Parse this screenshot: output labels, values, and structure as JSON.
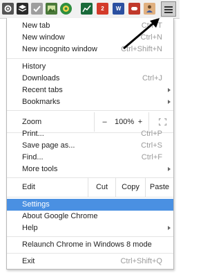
{
  "toolbar": {
    "extensions": [
      {
        "icon": "gear-icon",
        "bg": "#555555"
      },
      {
        "icon": "layers-icon",
        "bg": "#2b2b2b"
      },
      {
        "icon": "check-icon",
        "bg": "#9e9e9e"
      },
      {
        "icon": "image-icon",
        "bg": "#4a7a3a"
      },
      {
        "icon": "circle-badge-icon",
        "bg": "#2f8f3f"
      },
      {
        "icon": "chart-icon",
        "bg": "#1a6a3a"
      },
      {
        "icon": "mail-badge-icon",
        "bg": "#d33a2a",
        "text": "2"
      },
      {
        "icon": "word-badge-icon",
        "bg": "#2a4fa0",
        "text": "W"
      },
      {
        "icon": "pill-icon",
        "bg": "#c0392b"
      },
      {
        "icon": "person-icon",
        "bg": "#e0b080"
      }
    ],
    "menu_button_icon": "hamburger-menu-icon"
  },
  "menu": {
    "new_tab": "New tab",
    "new_tab_shortcut": "Ctrl+T",
    "new_window": "New window",
    "new_window_shortcut": "Ctrl+N",
    "new_incognito": "New incognito window",
    "new_incognito_shortcut": "Ctrl+Shift+N",
    "history": "History",
    "downloads": "Downloads",
    "downloads_shortcut": "Ctrl+J",
    "recent_tabs": "Recent tabs",
    "bookmarks": "Bookmarks",
    "zoom": "Zoom",
    "zoom_minus": "–",
    "zoom_value": "100%",
    "zoom_plus": "+",
    "print": "Print...",
    "print_shortcut": "Ctrl+P",
    "save_page": "Save page as...",
    "save_page_shortcut": "Ctrl+S",
    "find": "Find...",
    "find_shortcut": "Ctrl+F",
    "more_tools": "More tools",
    "edit": "Edit",
    "cut": "Cut",
    "copy": "Copy",
    "paste": "Paste",
    "settings": "Settings",
    "about": "About Google Chrome",
    "help": "Help",
    "relaunch": "Relaunch Chrome in Windows 8 mode",
    "exit": "Exit",
    "exit_shortcut": "Ctrl+Shift+Q"
  },
  "colors": {
    "highlight": "#4a90e2",
    "annotation_arrow": "#000000"
  }
}
